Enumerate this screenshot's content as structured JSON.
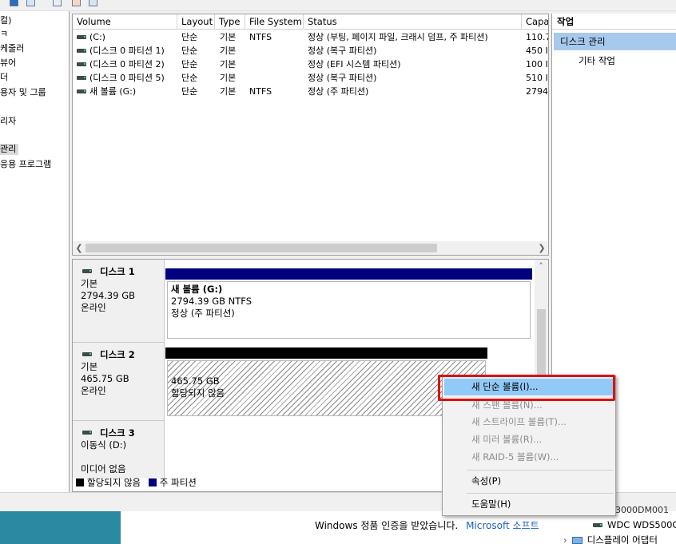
{
  "tree": {
    "items": [
      {
        "label": "컬)",
        "selected": false
      },
      {
        "label": "ㅋ",
        "selected": false
      },
      {
        "label": "케줄러",
        "selected": false
      },
      {
        "label": "뷰어",
        "selected": false
      },
      {
        "label": "더",
        "selected": false
      },
      {
        "label": "용자 및 그룹",
        "selected": false
      },
      {
        "label": "리자",
        "selected": false
      },
      {
        "label": "관리",
        "selected": true
      },
      {
        "label": "응용 프로그램",
        "selected": false
      }
    ]
  },
  "volume_list": {
    "columns": [
      "Volume",
      "Layout",
      "Type",
      "File System",
      "Status",
      "Capa"
    ],
    "rows": [
      {
        "volume": "(C:)",
        "layout": "단순",
        "type": "기본",
        "fs": "NTFS",
        "status": "정상 (부팅, 페이지 파일, 크래시 덤프, 주 파티션)",
        "capacity": "110.7"
      },
      {
        "volume": "(디스크 0 파티션 1)",
        "layout": "단순",
        "type": "기본",
        "fs": "",
        "status": "정상 (복구 파티션)",
        "capacity": "450 I"
      },
      {
        "volume": "(디스크 0 파티션 2)",
        "layout": "단순",
        "type": "기본",
        "fs": "",
        "status": "정상 (EFI 시스템 파티션)",
        "capacity": "100 I"
      },
      {
        "volume": "(디스크 0 파티션 5)",
        "layout": "단순",
        "type": "기본",
        "fs": "",
        "status": "정상 (복구 파티션)",
        "capacity": "510 I"
      },
      {
        "volume": "새 볼륨 (G:)",
        "layout": "단순",
        "type": "기본",
        "fs": "NTFS",
        "status": "정상 (주 파티션)",
        "capacity": "2794"
      }
    ]
  },
  "actions": {
    "title": "작업",
    "section": "디스크 관리",
    "more": "기타 작업"
  },
  "disks": [
    {
      "name": "디스크 1",
      "kind": "기본",
      "size": "2794.39 GB",
      "state": "온라인",
      "partition": {
        "name": "새 볼륨  (G:)",
        "size": "2794.39 GB NTFS",
        "status": "정상 (주 파티션)"
      }
    },
    {
      "name": "디스크 2",
      "kind": "기본",
      "size": "465.75 GB",
      "state": "온라인",
      "partition": {
        "size": "465.75 GB",
        "status": "할당되지 않음"
      }
    },
    {
      "name": "디스크 3",
      "kind": "이동식 (D:)",
      "state": "미디어 없음"
    }
  ],
  "legend": {
    "unallocated": "할당되지 않음",
    "primary": "주 파티션"
  },
  "colors": {
    "primary": "#00007f",
    "unallocated": "#000000",
    "highlight": "#91c9f7",
    "callout": "#e01010",
    "selection": "#a7c9ee"
  },
  "context_menu": {
    "items": [
      {
        "label": "새 단순 볼륨(I)...",
        "enabled": true,
        "highlighted": true
      },
      {
        "label": "새 스팬 볼륨(N)...",
        "enabled": false
      },
      {
        "label": "새 스트라이프 볼륨(T)...",
        "enabled": false
      },
      {
        "label": "새 미러 볼륨(R)...",
        "enabled": false
      },
      {
        "label": "새 RAID-5 볼륨(W)...",
        "enabled": false
      },
      {
        "label": "속성(P)",
        "enabled": true
      },
      {
        "label": "도움말(H)",
        "enabled": true
      }
    ]
  },
  "background": {
    "activation_text": "Windows 정품 인증을 받았습니다.",
    "activation_link": "Microsoft 소프트",
    "device_top": "3000DM001",
    "device1": "WDC WDS500G",
    "device2": "디스플레이 어댑터"
  }
}
